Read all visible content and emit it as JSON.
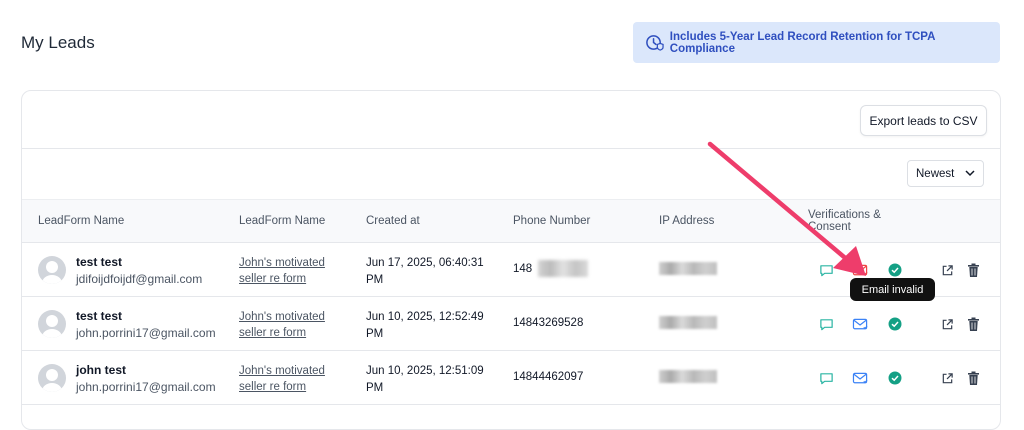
{
  "page": {
    "title": "My Leads"
  },
  "banner": {
    "text": "Includes 5-Year Lead Record Retention for TCPA Compliance",
    "icon": "clock-shield-icon"
  },
  "toolbar": {
    "export_label": "Export leads to CSV"
  },
  "sort": {
    "selected": "Newest"
  },
  "table": {
    "headers": [
      "LeadForm Name",
      "LeadForm Name",
      "Created at",
      "Phone Number",
      "IP Address",
      "Verifications & Consent"
    ],
    "rows": [
      {
        "name": "test test",
        "email": "jdifoijdfoijdf@gmail.com",
        "form": "John's motivated seller re form",
        "created": "Jun 17, 2025, 06:40:31 PM",
        "phone": "148",
        "email_status": "invalid"
      },
      {
        "name": "test test",
        "email": "john.porrini17@gmail.com",
        "form": "John's motivated seller re form",
        "created": "Jun 10, 2025, 12:52:49 PM",
        "phone": "14843269528",
        "email_status": "valid"
      },
      {
        "name": "john test",
        "email": "john.porrini17@gmail.com",
        "form": "John's motivated seller re form",
        "created": "Jun 10, 2025, 12:51:09 PM",
        "phone": "14844462097",
        "email_status": "valid"
      }
    ]
  },
  "tooltip": {
    "text": "Email invalid"
  },
  "colors": {
    "accent": "#2f4fbf",
    "banner_bg": "#dbe7fb",
    "sms": "#2bb5a4",
    "mail_valid": "#3b82f6",
    "mail_invalid": "#ef4444",
    "verified": "#14a085",
    "arrow": "#ee3d6b"
  }
}
